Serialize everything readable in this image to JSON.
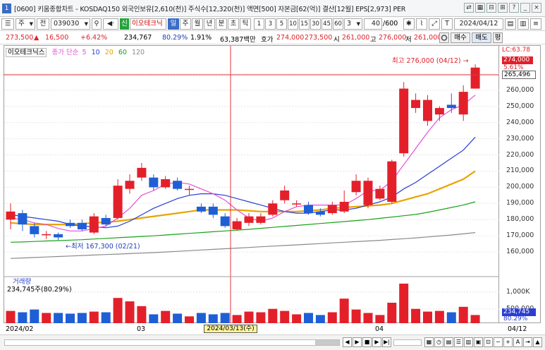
{
  "window": {
    "number": "1",
    "title": "[0600] 키움종합차트 - KOSDAQ150 외국인보유[2,610(천)] 주식수[12,320(천)] 액면[500] 자본금[62(억)] 결산[12월] EPS[2,973] PER"
  },
  "toolbar": {
    "period": "주",
    "prev_label": "전",
    "code": "039030",
    "badge": "신",
    "stock_name": "이오테크닉",
    "period_buttons": [
      "일",
      "주",
      "월",
      "년",
      "분",
      "초",
      "틱"
    ],
    "interval_buttons": [
      "1",
      "3",
      "5",
      "10",
      "15",
      "30",
      "45",
      "60"
    ],
    "interval_value": "3",
    "count_value": "40",
    "count_total": "/600",
    "date_value": "2024/04/12"
  },
  "quote": {
    "price": "273,500",
    "change_arrow": "▲",
    "change": "16,500",
    "change_pct": "+6.42%",
    "volume": "234,767",
    "volume_ratio": "80.29%",
    "turnover": "1.91%",
    "amount": "63,387백만",
    "bid_label": "호가",
    "bid_ask": "274,000",
    "bid_bid": "273,500",
    "open_label": "시",
    "open": "261,000",
    "high_label": "고",
    "high": "276,000",
    "low_label": "저",
    "low": "261,000",
    "buy_label": "매수",
    "sell_label": "매도",
    "avg_label": "평"
  },
  "legend": {
    "name": "이오테크닉스",
    "ma_label": "종가 단순",
    "ma_periods": [
      "5",
      "10",
      "20",
      "60",
      "120"
    ],
    "ma_colors": [
      "#e64fd6",
      "#2a3fd0",
      "#e8a400",
      "#1aa21a",
      "#8a8a8a"
    ]
  },
  "annotations": {
    "high_label": "최고 276,000 (04/12)",
    "low_label": "최저 167,300 (02/21)",
    "crosshair_date": "2024/03/13(수)",
    "lc_label": "LC:63.78",
    "price_badge": "274,000",
    "pct_badge": "5.61%",
    "cross_price": "265,496"
  },
  "volume_panel": {
    "title": "거래량",
    "value": "234,745주(80.29%)",
    "ticks": [
      "1,000K",
      "500,000"
    ],
    "badge_vol": "234,745",
    "badge_pct": "80.29%"
  },
  "x_labels": [
    "2024/02",
    "03",
    "04"
  ],
  "x_right_label": "04/12",
  "chart_data": {
    "type": "candlestick",
    "ylim": [
      150000,
      280000
    ],
    "yticks": [
      "270,000",
      "260,000",
      "250,000",
      "240,000",
      "230,000",
      "220,000",
      "210,000",
      "200,000",
      "190,000",
      "180,000",
      "170,000",
      "160,000"
    ],
    "candles": [
      {
        "o": 180000,
        "c": 185000,
        "h": 190000,
        "l": 174000,
        "v": 180
      },
      {
        "o": 184000,
        "c": 177000,
        "h": 186000,
        "l": 173000,
        "v": 160
      },
      {
        "o": 176000,
        "c": 171000,
        "h": 178000,
        "l": 169000,
        "v": 200
      },
      {
        "o": 171000,
        "c": 171000,
        "h": 173000,
        "l": 168000,
        "v": 150
      },
      {
        "o": 171000,
        "c": 169000,
        "h": 172000,
        "l": 167300,
        "v": 150
      },
      {
        "o": 178000,
        "c": 176000,
        "h": 180000,
        "l": 175000,
        "v": 140
      },
      {
        "o": 178000,
        "c": 174000,
        "h": 180000,
        "l": 173000,
        "v": 150
      },
      {
        "o": 172000,
        "c": 182000,
        "h": 184000,
        "l": 171000,
        "v": 170
      },
      {
        "o": 181000,
        "c": 177000,
        "h": 183000,
        "l": 176000,
        "v": 160
      },
      {
        "o": 181000,
        "c": 201000,
        "h": 205000,
        "l": 180000,
        "v": 370
      },
      {
        "o": 199000,
        "c": 204000,
        "h": 208000,
        "l": 196000,
        "v": 320
      },
      {
        "o": 206000,
        "c": 212000,
        "h": 215000,
        "l": 204000,
        "v": 250
      },
      {
        "o": 206000,
        "c": 200000,
        "h": 208000,
        "l": 198000,
        "v": 130
      },
      {
        "o": 200000,
        "c": 205000,
        "h": 207000,
        "l": 199000,
        "v": 180
      },
      {
        "o": 204000,
        "c": 199000,
        "h": 206000,
        "l": 198000,
        "v": 140
      },
      {
        "o": 199000,
        "c": 199000,
        "h": 201000,
        "l": 195000,
        "v": 100
      },
      {
        "o": 188000,
        "c": 185000,
        "h": 190000,
        "l": 184000,
        "v": 150
      },
      {
        "o": 188000,
        "c": 183000,
        "h": 190000,
        "l": 181000,
        "v": 130
      },
      {
        "o": 182000,
        "c": 176000,
        "h": 184000,
        "l": 175000,
        "v": 150
      },
      {
        "o": 174000,
        "c": 179000,
        "h": 181000,
        "l": 173000,
        "v": 120
      },
      {
        "o": 178000,
        "c": 182000,
        "h": 184000,
        "l": 176000,
        "v": 170
      },
      {
        "o": 178000,
        "c": 182000,
        "h": 184000,
        "l": 177000,
        "v": 160
      },
      {
        "o": 183000,
        "c": 190000,
        "h": 192000,
        "l": 182000,
        "v": 210
      },
      {
        "o": 192000,
        "c": 198000,
        "h": 201000,
        "l": 190000,
        "v": 180
      },
      {
        "o": 190000,
        "c": 190000,
        "h": 192000,
        "l": 188000,
        "v": 130
      },
      {
        "o": 189000,
        "c": 184000,
        "h": 191000,
        "l": 183000,
        "v": 150
      },
      {
        "o": 185000,
        "c": 183000,
        "h": 187000,
        "l": 182000,
        "v": 120
      },
      {
        "o": 184000,
        "c": 189000,
        "h": 191000,
        "l": 183000,
        "v": 160
      },
      {
        "o": 185000,
        "c": 191000,
        "h": 198000,
        "l": 184000,
        "v": 360
      },
      {
        "o": 197000,
        "c": 204000,
        "h": 208000,
        "l": 195000,
        "v": 200
      },
      {
        "o": 189000,
        "c": 204000,
        "h": 206000,
        "l": 187000,
        "v": 150
      },
      {
        "o": 193000,
        "c": 199000,
        "h": 201000,
        "l": 192000,
        "v": 120
      },
      {
        "o": 191000,
        "c": 216000,
        "h": 217000,
        "l": 190000,
        "v": 300
      },
      {
        "o": 221000,
        "c": 261000,
        "h": 265000,
        "l": 219000,
        "v": 580
      },
      {
        "o": 249000,
        "c": 254000,
        "h": 258000,
        "l": 246000,
        "v": 210
      },
      {
        "o": 241000,
        "c": 254000,
        "h": 257000,
        "l": 238000,
        "v": 170
      },
      {
        "o": 245000,
        "c": 249000,
        "h": 250000,
        "l": 241000,
        "v": 180
      },
      {
        "o": 251000,
        "c": 249000,
        "h": 258000,
        "l": 246000,
        "v": 160
      },
      {
        "o": 245000,
        "c": 259000,
        "h": 263000,
        "l": 241000,
        "v": 240
      },
      {
        "o": 261000,
        "c": 274000,
        "h": 276000,
        "l": 261000,
        "v": 120
      }
    ],
    "ma5": [
      181000,
      180000,
      178000,
      177000,
      174500,
      173000,
      173000,
      174500,
      176000,
      181000,
      187000,
      195000,
      198000,
      202000,
      203000,
      202000,
      199000,
      196000,
      192000,
      186000,
      181000,
      179000,
      181000,
      185000,
      188000,
      189000,
      189000,
      189000,
      189000,
      193000,
      198000,
      198000,
      204000,
      214000,
      224000,
      234000,
      243000,
      248000,
      251000,
      257000
    ],
    "ma10": [
      183000,
      182000,
      181000,
      180000,
      179000,
      177000,
      176000,
      175500,
      175000,
      176000,
      179000,
      183000,
      187000,
      190000,
      193000,
      195000,
      196000,
      196000,
      195000,
      193000,
      191000,
      189000,
      187000,
      185000,
      184000,
      184000,
      185000,
      186000,
      186000,
      187000,
      189000,
      191000,
      194000,
      199000,
      203000,
      208000,
      213000,
      218000,
      223000,
      231000
    ],
    "ma20": [
      178000,
      177500,
      177000,
      177000,
      177000,
      177000,
      177500,
      178000,
      178500,
      179000,
      180000,
      181000,
      182000,
      183000,
      184000,
      185000,
      186000,
      186000,
      186000,
      186000,
      185500,
      185000,
      185000,
      185000,
      185000,
      185500,
      186000,
      187000,
      187500,
      188000,
      188500,
      189000,
      190000,
      192000,
      194000,
      196000,
      199000,
      202000,
      205000,
      210000
    ],
    "ma60": [
      166000,
      166200,
      166500,
      166800,
      167000,
      167300,
      167600,
      168000,
      168400,
      168800,
      169200,
      169600,
      170000,
      170500,
      171000,
      171500,
      172000,
      172500,
      173000,
      173500,
      174000,
      174600,
      175200,
      175800,
      176400,
      177000,
      177600,
      178200,
      178800,
      179400,
      180000,
      180800,
      181600,
      182400,
      183200,
      184500,
      186000,
      187500,
      189000,
      191000
    ],
    "ma120": [
      156000,
      156300,
      156600,
      156900,
      157200,
      157500,
      157800,
      158100,
      158400,
      158700,
      159000,
      159300,
      159600,
      160000,
      160400,
      160800,
      161200,
      161600,
      162000,
      162400,
      162800,
      163200,
      163600,
      164000,
      164400,
      164800,
      165200,
      165600,
      166000,
      166400,
      166800,
      167200,
      167700,
      168200,
      168700,
      169300,
      169900,
      170500,
      171200,
      172000
    ]
  }
}
